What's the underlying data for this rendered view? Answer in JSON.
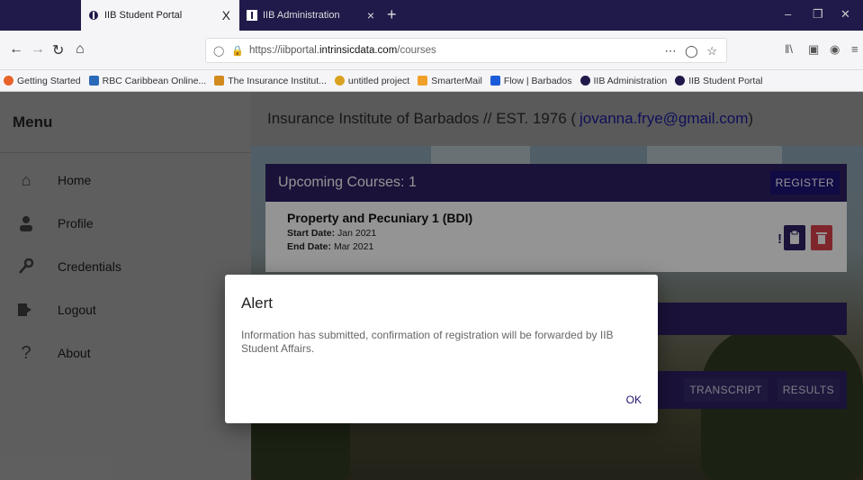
{
  "browser": {
    "tabs": [
      {
        "title": "IIB Student Portal",
        "close": "X"
      },
      {
        "title": "IIB Administration",
        "close": "×"
      }
    ],
    "new_tab": "+",
    "url": {
      "prefix": "https://iibportal.",
      "host": "intrinsicdata.com",
      "path": "/courses"
    },
    "bookmarks": [
      {
        "label": "Getting Started",
        "color": "#e8632a"
      },
      {
        "label": "RBC Caribbean Online...",
        "color": "#2a6ab8"
      },
      {
        "label": "The Insurance Institut...",
        "color": "#d28b1e"
      },
      {
        "label": "untitled project",
        "color": "#d9a321"
      },
      {
        "label": "SmarterMail",
        "color": "#f0a02a"
      },
      {
        "label": "Flow | Barbados",
        "color": "#1a5bd8"
      },
      {
        "label": "IIB Administration",
        "color": "#1f1a4a"
      },
      {
        "label": "IIB Student Portal",
        "color": "#1f1a4a"
      }
    ]
  },
  "sidebar": {
    "title": "Menu",
    "items": [
      {
        "label": "Home",
        "icon": "home-icon"
      },
      {
        "label": "Profile",
        "icon": "user-icon"
      },
      {
        "label": "Credentials",
        "icon": "key-icon"
      },
      {
        "label": "Logout",
        "icon": "logout-icon"
      },
      {
        "label": "About",
        "icon": "question-icon"
      }
    ]
  },
  "header": {
    "title": "Insurance Institute of Barbados // EST. 1976 (",
    "email": "jovanna.frye@gmail.com",
    "title_end": ")"
  },
  "upcoming": {
    "heading": "Upcoming Courses: 1",
    "register_label": "REGISTER",
    "course": {
      "name": "Property and Pecuniary 1 (BDI)",
      "start_label": "Start Date:",
      "start_value": "Jan 2021",
      "end_label": "End Date:",
      "end_value": "Mar 2021",
      "alert_mark": "!"
    }
  },
  "records": {
    "transcript_label": "TRANSCRIPT",
    "results_label": "RESULTS"
  },
  "dialog": {
    "title": "Alert",
    "message": "Information has submitted, confirmation of registration will be forwarded by IIB Student Affairs.",
    "ok_label": "OK"
  },
  "colors": {
    "brand_purple": "#2e1f63",
    "delete_red": "#d9434a"
  }
}
